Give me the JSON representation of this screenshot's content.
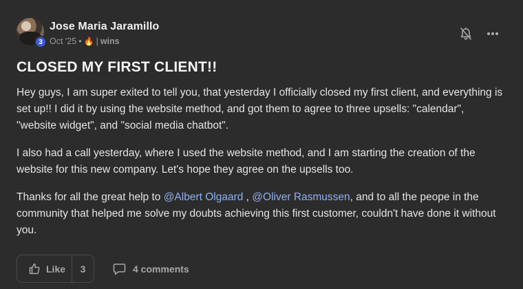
{
  "author": {
    "name": "Jose Maria Jaramillo",
    "level": "3",
    "date": "Oct '25",
    "dot": "•",
    "fire": "🔥",
    "sep": "|",
    "category": "wins"
  },
  "post": {
    "title": "CLOSED MY FIRST CLIENT!!",
    "p1": "Hey guys, I am super exited to tell you, that yesterday I officially closed my first client, and everything is set up!! I did it by using the website method, and got them to agree to three upsells: \"calendar\", \"website widget\", and \"social media chatbot\".",
    "p2": "I also had a call yesterday, where I used the website method, and I am starting the creation of the website for this new company. Let's hope they agree on the upsells too.",
    "p3_a": "Thanks for all the great help to ",
    "mention1": "@Albert Olgaard",
    "p3_b": " , ",
    "mention2": "@Oliver Rasmussen",
    "p3_c": ", and to all the peope in the community that helped me solve my doubts achieving this first customer, couldn't have done it without you."
  },
  "footer": {
    "like_label": "Like",
    "like_count": "3",
    "comments_label": "4 comments"
  },
  "icons": {
    "bell": "bell-off-icon",
    "more": "more-horizontal-icon",
    "like": "thumbs-up-icon",
    "comment": "comment-icon"
  },
  "colors": {
    "background": "#2d2c2c",
    "mention": "#8fb0f0",
    "level_badge": "#3d5bd6"
  }
}
